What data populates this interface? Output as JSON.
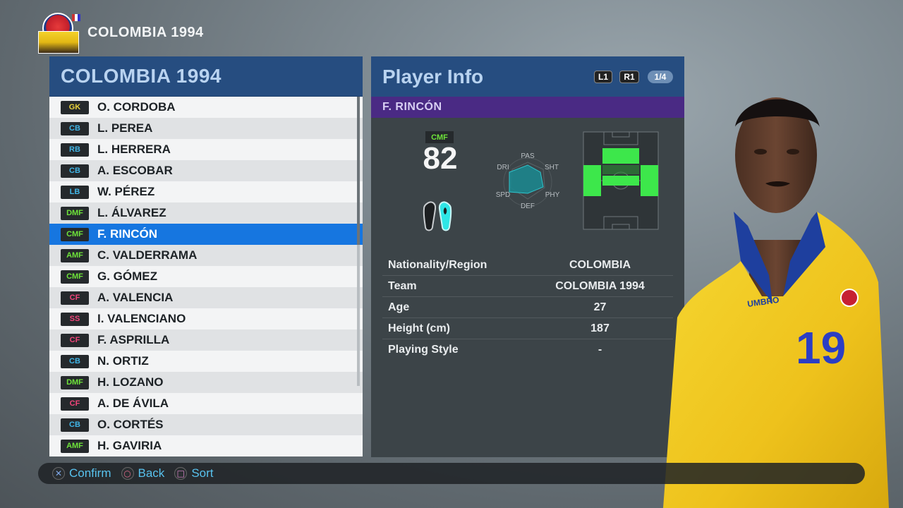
{
  "header": {
    "title": "COLOMBIA 1994"
  },
  "roster": {
    "title": "COLOMBIA 1994",
    "players": [
      {
        "pos": "GK",
        "name": "O. CORDOBA",
        "group": "GK"
      },
      {
        "pos": "CB",
        "name": "L. PEREA",
        "group": "DEF"
      },
      {
        "pos": "RB",
        "name": "L. HERRERA",
        "group": "DEF"
      },
      {
        "pos": "CB",
        "name": "A. ESCOBAR",
        "group": "DEF"
      },
      {
        "pos": "LB",
        "name": "W. PÉREZ",
        "group": "DEF"
      },
      {
        "pos": "DMF",
        "name": "L. ÁLVAREZ",
        "group": "MID"
      },
      {
        "pos": "CMF",
        "name": "F. RINCÓN",
        "group": "MID",
        "selected": true
      },
      {
        "pos": "AMF",
        "name": "C. VALDERRAMA",
        "group": "MID"
      },
      {
        "pos": "CMF",
        "name": "G. GÓMEZ",
        "group": "MID"
      },
      {
        "pos": "CF",
        "name": "A. VALENCIA",
        "group": "ATT"
      },
      {
        "pos": "SS",
        "name": "I. VALENCIANO",
        "group": "ATT"
      },
      {
        "pos": "CF",
        "name": "F. ASPRILLA",
        "group": "ATT"
      },
      {
        "pos": "CB",
        "name": "N. ORTIZ",
        "group": "DEF"
      },
      {
        "pos": "DMF",
        "name": "H. LOZANO",
        "group": "MID"
      },
      {
        "pos": "CF",
        "name": "A. DE ÁVILA",
        "group": "ATT"
      },
      {
        "pos": "CB",
        "name": "O. CORTÉS",
        "group": "DEF"
      },
      {
        "pos": "AMF",
        "name": "H. GAVIRIA",
        "group": "MID"
      }
    ]
  },
  "info": {
    "title": "Player Info",
    "l1": "L1",
    "r1": "R1",
    "page": "1/4",
    "player_name": "F. RINCÓN",
    "position": "CMF",
    "rating": "82",
    "radar_labels": {
      "pas": "PAS",
      "sht": "SHT",
      "phy": "PHY",
      "def": "DEF",
      "spd": "SPD",
      "dri": "DRI"
    },
    "rows": [
      {
        "label": "Nationality/Region",
        "value": "COLOMBIA"
      },
      {
        "label": "Team",
        "value": "COLOMBIA 1994"
      },
      {
        "label": "Age",
        "value": "27"
      },
      {
        "label": "Height (cm)",
        "value": "187"
      },
      {
        "label": "Playing Style",
        "value": "-"
      }
    ]
  },
  "jersey": {
    "brand": "UMBRO",
    "number": "19"
  },
  "hints": [
    {
      "icon": "cross-icon",
      "symbol": "✕",
      "label": "Confirm",
      "color": "#7fa8e8"
    },
    {
      "icon": "circle-icon",
      "symbol": "○",
      "label": "Back",
      "color": "#e06a8a"
    },
    {
      "icon": "square-icon",
      "symbol": "□",
      "label": "Sort",
      "color": "#e08ad0"
    }
  ],
  "colors": {
    "accent": "#1676e0",
    "header": "#264d80",
    "name_bar": "#4a2a84",
    "jersey": "#f2cf1f"
  }
}
